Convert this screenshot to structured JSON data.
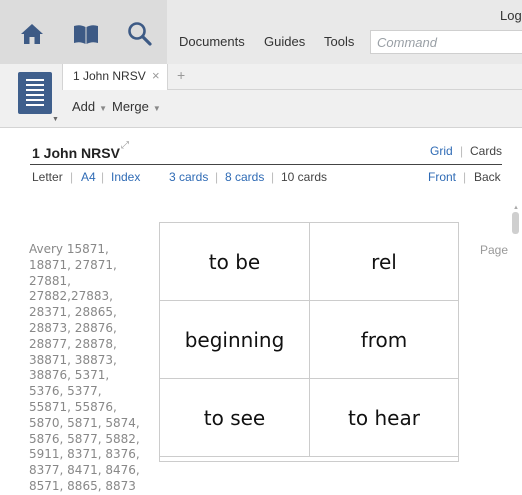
{
  "toolbar": {
    "logout": "Logo",
    "nav": [
      "Documents",
      "Guides",
      "Tools"
    ],
    "command_placeholder": "Command"
  },
  "icons": {
    "home": "home-icon",
    "library": "book-icon",
    "search": "search-icon",
    "document": "document-list-icon"
  },
  "tabs": [
    {
      "label": "1 John NRSV",
      "close": "×"
    }
  ],
  "tab_add": "+",
  "menus": {
    "add": "Add",
    "merge": "Merge"
  },
  "doc": {
    "title": "1 John NRSV",
    "expand": "⤢",
    "view_options": {
      "grid": "Grid",
      "cards": "Cards",
      "sep": "|"
    },
    "formats": [
      "Letter",
      "A4",
      "Index"
    ],
    "card_counts": [
      "3 cards",
      "8 cards",
      "10 cards"
    ],
    "sides": {
      "front": "Front",
      "back": "Back"
    }
  },
  "avery_text": "Avery 15871, 18871, 27871, 27881, 27882,27883, 28371, 28865, 28873, 28876, 28877, 28878, 38871, 38873, 38876, 5371, 5376, 5377, 55871, 55876, 5870, 5871, 5874, 5876, 5877, 5882, 5911, 8371, 8376, 8377, 8471, 8476, 8571, 8865, 8873",
  "cards": [
    "to be",
    "rel",
    "beginning",
    "from",
    "to see",
    "to hear"
  ],
  "page_label": "Page",
  "colors": {
    "accent": "#2f6bb5",
    "doc_icon": "#3f5f8c"
  }
}
